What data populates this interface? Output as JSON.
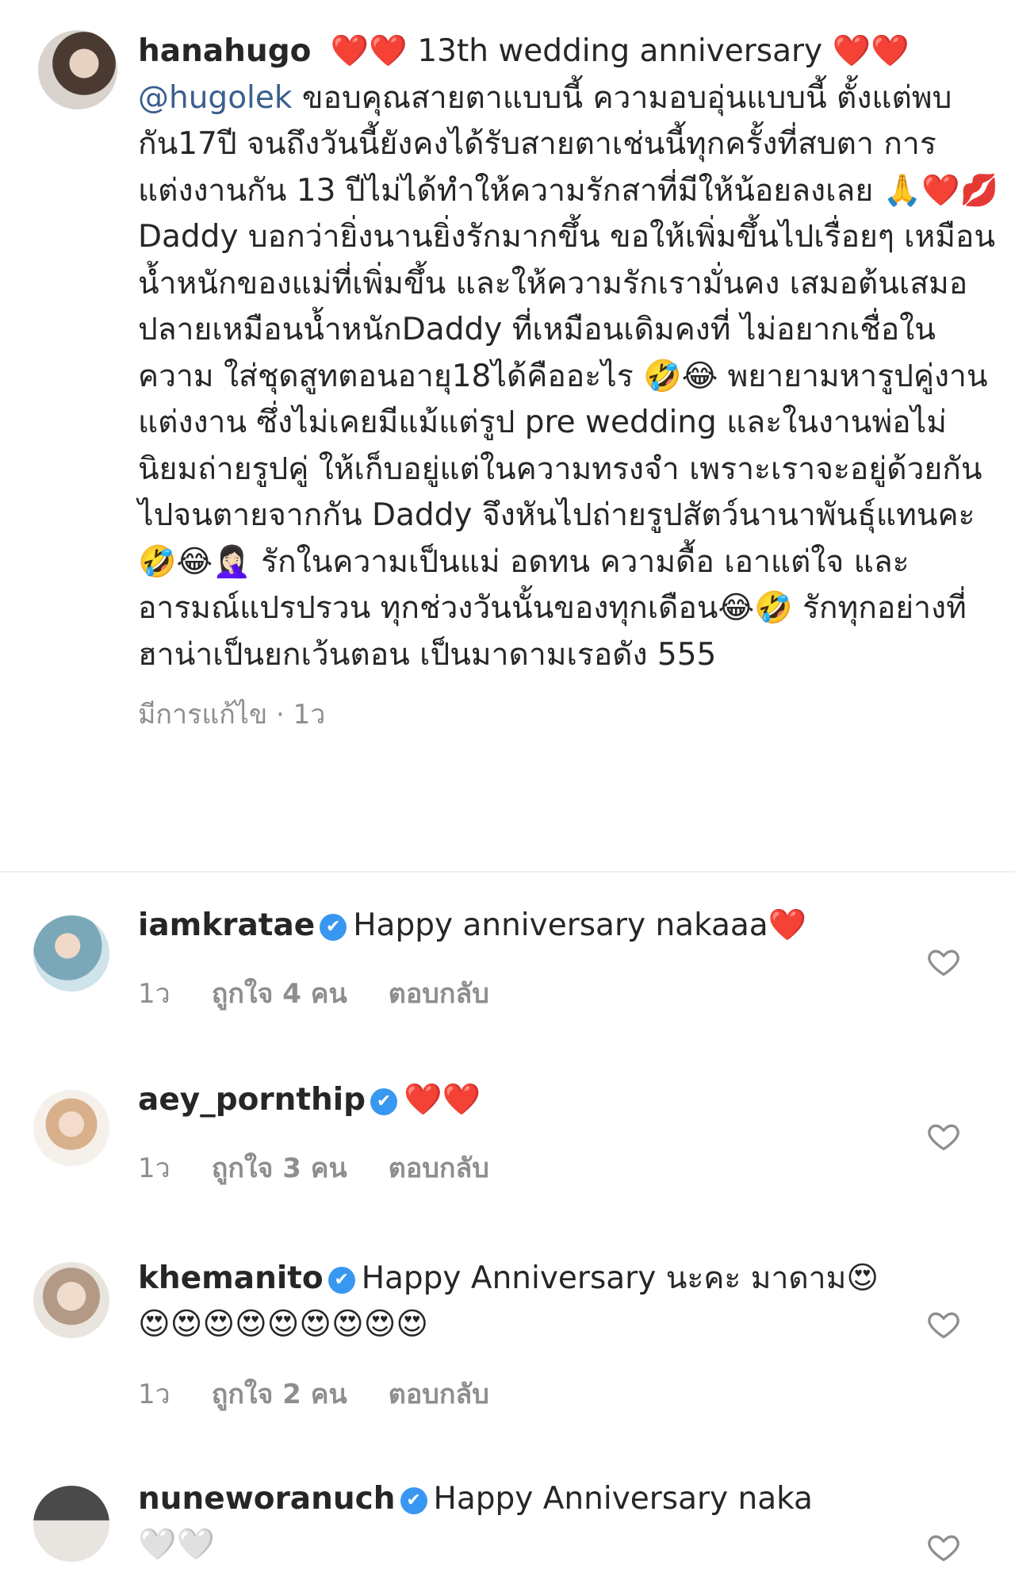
{
  "post": {
    "username": "hanahugo",
    "caption_hearts": "❤️❤️",
    "caption_title": "13th wedding anniversary",
    "caption_hearts2": "❤️❤️",
    "mention": "@hugolek",
    "caption_body": "ขอบคุณสายตาแบบนี้ ความอบอุ่นแบบนี้ ตั้งแต่พบกัน17ปี จนถึงวันนี้ยังคงได้รับสายตาเช่นนี้ทุกครั้งที่สบตา การแต่งงานกัน 13 ปีไม่ได้ทำให้ความรักสาที่มีให้น้อยลงเลย 🙏❤️💋Daddy บอกว่ายิ่งนานยิ่งรักมากขึ้น ขอให้เพิ่มขึ้นไปเรื่อยๆ เหมือนน้ำหนักของแม่ที่เพิ่มขึ้น และให้ความรักเรามั่นคง เสมอต้นเสมอปลายเหมือนน้ำหนักDaddy ที่เหมือนเดิมคงที่ ไม่อยากเชื่อในความ ใส่ชุดสูทตอนอายุ18ได้คืออะไร 🤣😂 พยายามหารูปคู่งานแต่งงาน ซึ่งไม่เคยมีแม้แต่รูป pre wedding และในงานพ่อไม่นิยมถ่ายรูปคู่ ให้เก็บอยู่แต่ในความทรงจำ เพราะเราจะอยู่ด้วยกันไปจนตายจากกัน Daddy จึงหันไปถ่ายรูปสัตว์นานาพันธุ์แทนคะ 🤣😂🤦🏻‍♀️ รักในความเป็นแม่ อดทน ความดื้อ เอาแต่ใจ และอารมณ์แปรปรวน ทุกช่วงวันนั้นของทุกเดือน😂🤣 รักทุกอย่างที่ฮาน่าเป็นยกเว้นตอน เป็นมาดามเรอดัง 555",
    "meta": "มีการแก้ไข · 1ว"
  },
  "comments": [
    {
      "username": "iamkratae",
      "verified": "✔",
      "text": "Happy anniversary nakaaa❤️",
      "time": "1ว",
      "likes": "ถูกใจ 4 คน",
      "reply": "ตอบกลับ"
    },
    {
      "username": "aey_pornthip",
      "verified": "✔",
      "text": "❤️❤️",
      "time": "1ว",
      "likes": "ถูกใจ 3 คน",
      "reply": "ตอบกลับ"
    },
    {
      "username": "khemanito",
      "verified": "✔",
      "text": "Happy Anniversary นะคะ มาดาม😍😍😍😍😍😍😍😍😍😍",
      "time": "1ว",
      "likes": "ถูกใจ 2 คน",
      "reply": "ตอบกลับ"
    },
    {
      "username": "nuneworanuch",
      "verified": "✔",
      "text": "Happy Anniversary naka",
      "text2": "🤍🤍"
    }
  ],
  "icons": {
    "like": "heart-outline-icon",
    "verified": "verified-badge-icon"
  },
  "colors": {
    "mention": "#3b5f8f",
    "meta": "#8e8e8e",
    "verified": "#3897f0"
  }
}
